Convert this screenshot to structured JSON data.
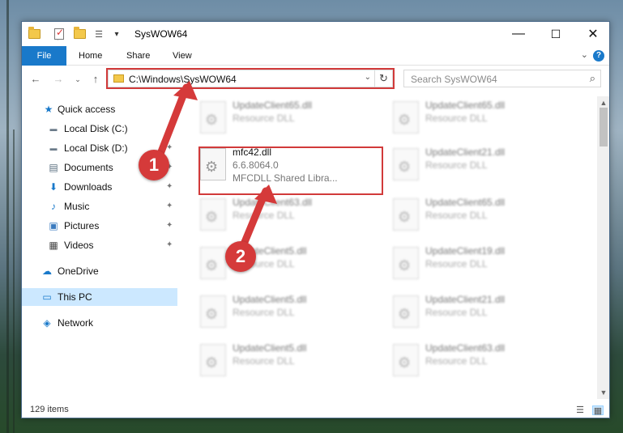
{
  "window": {
    "title": "SysWOW64",
    "qat_dropdown": "▾",
    "controls": {
      "minimize": "—",
      "maximize": "☐",
      "close": "✕"
    }
  },
  "ribbon": {
    "tabs": [
      "File",
      "Home",
      "Share",
      "View"
    ],
    "collapse": "⌄",
    "help": "?"
  },
  "nav": {
    "back": "←",
    "forward": "→",
    "recent": "⌄",
    "up": "↑",
    "address": "C:\\Windows\\SysWOW64",
    "address_dropdown": "⌄",
    "refresh": "↻",
    "search_placeholder": "Search SysWOW64",
    "search_icon": "⌕"
  },
  "sidebar": {
    "items": [
      {
        "label": "Quick access",
        "icon": "star-icon",
        "glyph": "★",
        "color": "#1979ca",
        "pinned": false
      },
      {
        "label": "Local Disk (C:)",
        "icon": "drive-icon",
        "glyph": "▬",
        "color": "#6b7b8a",
        "pinned": false
      },
      {
        "label": "Local Disk (D:)",
        "icon": "drive-icon",
        "glyph": "▬",
        "color": "#6b7b8a",
        "pinned": true
      },
      {
        "label": "Documents",
        "icon": "documents-icon",
        "glyph": "▤",
        "color": "#5a6f80",
        "pinned": true
      },
      {
        "label": "Downloads",
        "icon": "downloads-icon",
        "glyph": "⬇",
        "color": "#1979ca",
        "pinned": true
      },
      {
        "label": "Music",
        "icon": "music-icon",
        "glyph": "♪",
        "color": "#1979ca",
        "pinned": true
      },
      {
        "label": "Pictures",
        "icon": "pictures-icon",
        "glyph": "▣",
        "color": "#3a7bbf",
        "pinned": true
      },
      {
        "label": "Videos",
        "icon": "videos-icon",
        "glyph": "▦",
        "color": "#444",
        "pinned": true
      },
      {
        "label": "OneDrive",
        "icon": "onedrive-icon",
        "glyph": "☁",
        "color": "#1979ca",
        "pinned": false
      },
      {
        "label": "This PC",
        "icon": "this-pc-icon",
        "glyph": "▭",
        "color": "#1979ca",
        "pinned": false,
        "selected": true
      },
      {
        "label": "Network",
        "icon": "network-icon",
        "glyph": "◈",
        "color": "#1979ca",
        "pinned": false
      }
    ],
    "pin_glyph": "📌"
  },
  "files": [
    {
      "name": "UpdateClient65.dll",
      "type": "Resource DLL",
      "blur": true
    },
    {
      "name": "UpdateClient65.dll",
      "type": "Resource DLL",
      "blur": true
    },
    {
      "name": "mfc42.dll",
      "version": "6.6.8064.0",
      "type": "MFCDLL Shared Libra...",
      "blur": false,
      "highlighted": true
    },
    {
      "name": "UpdateClient21.dll",
      "type": "Resource DLL",
      "blur": true
    },
    {
      "name": "UpdateClient63.dll",
      "type": "Resource DLL",
      "blur": true
    },
    {
      "name": "UpdateClient65.dll",
      "type": "Resource DLL",
      "blur": true
    },
    {
      "name": "UpdateClient5.dll",
      "type": "Resource DLL",
      "blur": true
    },
    {
      "name": "UpdateClient19.dll",
      "type": "Resource DLL",
      "blur": true
    },
    {
      "name": "UpdateClient5.dll",
      "type": "Resource DLL",
      "blur": true
    },
    {
      "name": "UpdateClient21.dll",
      "type": "Resource DLL",
      "blur": true
    },
    {
      "name": "UpdateClient5.dll",
      "type": "Resource DLL",
      "blur": true
    },
    {
      "name": "UpdateClient63.dll",
      "type": "Resource DLL",
      "blur": true
    }
  ],
  "status": {
    "items": "129 items",
    "scroll_up": "▲",
    "scroll_down": "▼",
    "details_view": "☰",
    "tiles_view": "▦"
  },
  "annotations": {
    "step1": "1",
    "step2": "2",
    "color": "#d53a3a"
  }
}
